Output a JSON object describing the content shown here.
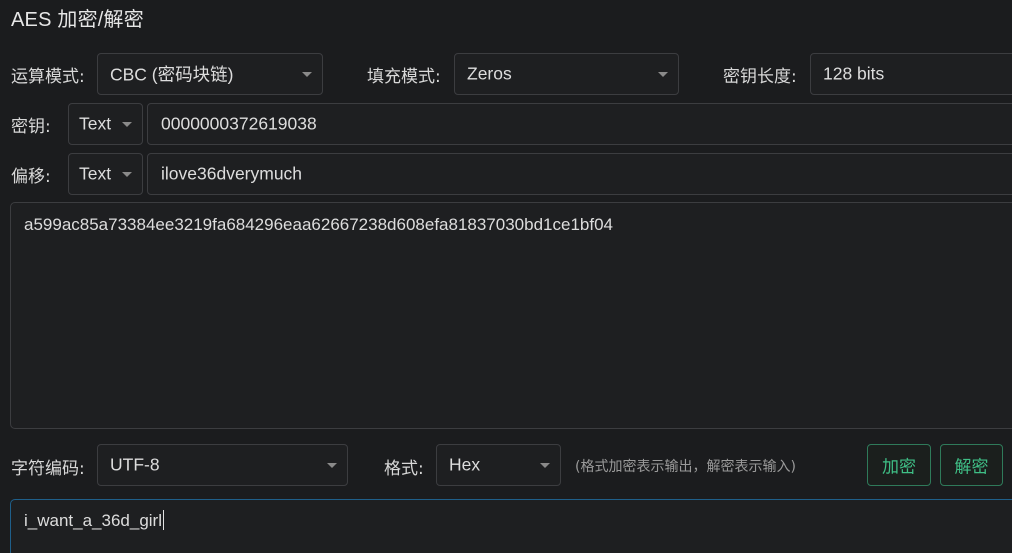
{
  "header": {
    "title": "AES 加密/解密"
  },
  "mode": {
    "label": "运算模式:",
    "value": "CBC (密码块链)"
  },
  "padding": {
    "label": "填充模式:",
    "value": "Zeros"
  },
  "key_length": {
    "label": "密钥长度:",
    "value": "128 bits"
  },
  "key": {
    "label": "密钥:",
    "format": "Text",
    "value": "0000000372619038"
  },
  "iv": {
    "label": "偏移:",
    "format": "Text",
    "value": "ilove36dverymuch"
  },
  "input": {
    "value": "a599ac85a73384ee3219fa684296eaa62667238d608efa81837030bd1ce1bf04"
  },
  "charset": {
    "label": "字符编码:",
    "value": "UTF-8"
  },
  "output_format": {
    "label": "格式:",
    "value": "Hex",
    "hint": "(格式加密表示输出，解密表示输入)"
  },
  "actions": {
    "encrypt_label": "加密",
    "decrypt_label": "解密"
  },
  "output": {
    "value": "i_want_a_36d_girl"
  },
  "colors": {
    "background": "#1b1c1e",
    "accent_green": "#3fbf86",
    "focus_blue": "#1f5f8a"
  }
}
